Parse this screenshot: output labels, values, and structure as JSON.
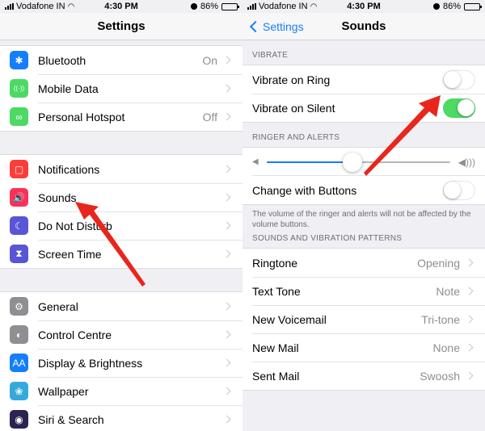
{
  "status_bar": {
    "carrier": "Vodafone IN",
    "time": "4:30 PM",
    "battery": "86%",
    "battery_level": 0.86
  },
  "left": {
    "title": "Settings",
    "groups": [
      [
        {
          "label": "Bluetooth",
          "value": "On",
          "icon": "bluetooth-icon",
          "glyph": "✱",
          "color": "#157efb"
        },
        {
          "label": "Mobile Data",
          "value": "",
          "icon": "antenna-icon",
          "glyph": "((·))",
          "color": "#4cd964"
        },
        {
          "label": "Personal Hotspot",
          "value": "Off",
          "icon": "hotspot-icon",
          "glyph": "∞",
          "color": "#4cd964"
        }
      ],
      [
        {
          "label": "Notifications",
          "value": "",
          "icon": "notifications-icon",
          "glyph": "▢",
          "color": "#fc3d39"
        },
        {
          "label": "Sounds",
          "value": "",
          "icon": "speaker-icon",
          "glyph": "🔊",
          "color": "#fc3158"
        },
        {
          "label": "Do Not Disturb",
          "value": "",
          "icon": "moon-icon",
          "glyph": "☾",
          "color": "#5856d6"
        },
        {
          "label": "Screen Time",
          "value": "",
          "icon": "hourglass-icon",
          "glyph": "⧗",
          "color": "#5856d6"
        }
      ],
      [
        {
          "label": "General",
          "value": "",
          "icon": "gear-icon",
          "glyph": "⚙",
          "color": "#8e8e93"
        },
        {
          "label": "Control Centre",
          "value": "",
          "icon": "toggles-icon",
          "glyph": "◐",
          "color": "#8e8e93"
        },
        {
          "label": "Display & Brightness",
          "value": "",
          "icon": "text-size-icon",
          "glyph": "AA",
          "color": "#157efb"
        },
        {
          "label": "Wallpaper",
          "value": "",
          "icon": "flower-icon",
          "glyph": "❀",
          "color": "#34aadc"
        },
        {
          "label": "Siri & Search",
          "value": "",
          "icon": "siri-icon",
          "glyph": "◉",
          "color": "#2b2350"
        }
      ]
    ]
  },
  "right": {
    "back_label": "Settings",
    "title": "Sounds",
    "vibrate": {
      "header": "VIBRATE",
      "rows": [
        {
          "label": "Vibrate on Ring",
          "on": false
        },
        {
          "label": "Vibrate on Silent",
          "on": true
        }
      ]
    },
    "ringer": {
      "header": "RINGER AND ALERTS",
      "volume": 0.47,
      "change_with_buttons_label": "Change with Buttons",
      "change_with_buttons_on": false,
      "footer": "The volume of the ringer and alerts will not be affected by the volume buttons."
    },
    "patterns": {
      "header": "SOUNDS AND VIBRATION PATTERNS",
      "rows": [
        {
          "label": "Ringtone",
          "value": "Opening"
        },
        {
          "label": "Text Tone",
          "value": "Note"
        },
        {
          "label": "New Voicemail",
          "value": "Tri-tone"
        },
        {
          "label": "New Mail",
          "value": "None"
        },
        {
          "label": "Sent Mail",
          "value": "Swoosh"
        }
      ]
    }
  },
  "colors": {
    "accent": "#157efb",
    "toggle_on": "#4cd964",
    "arrow": "#e8261c"
  }
}
